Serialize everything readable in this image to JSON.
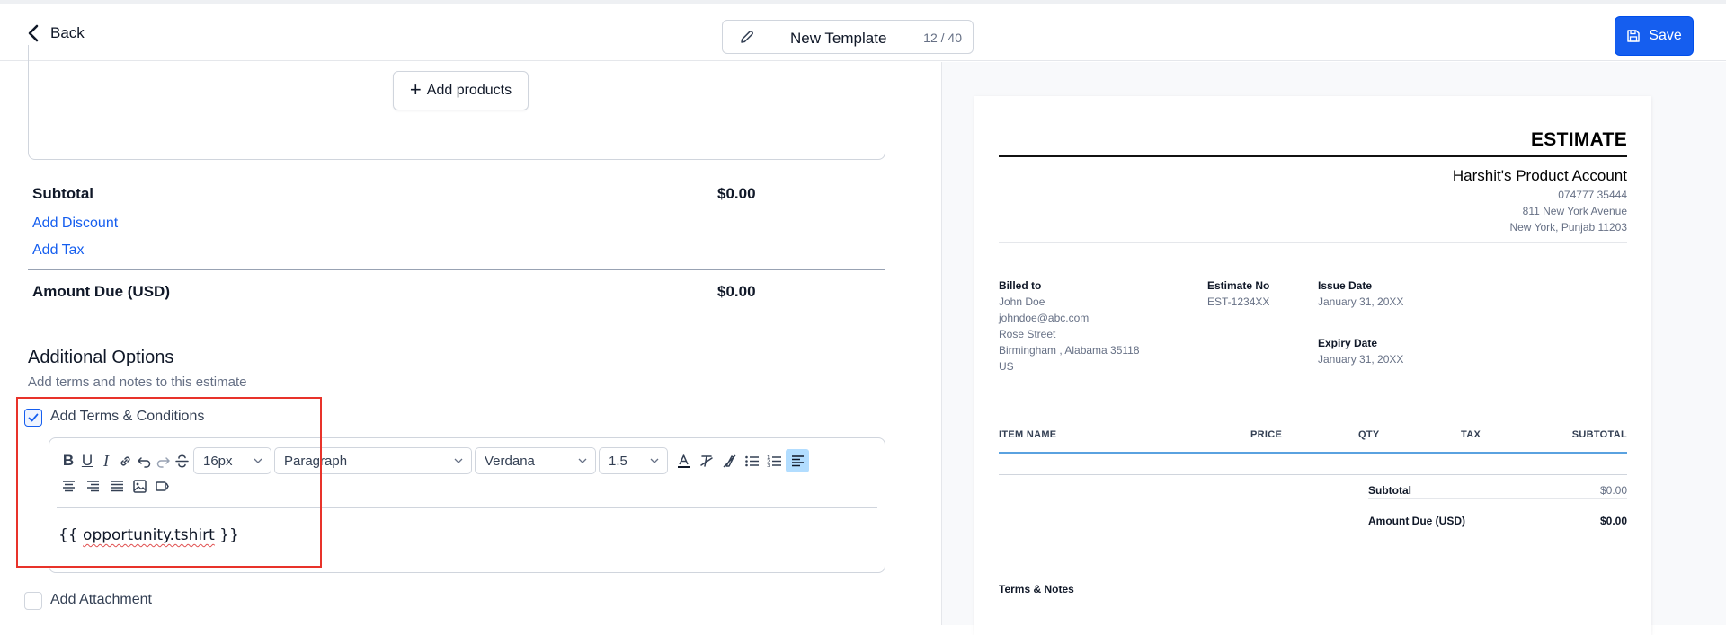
{
  "header": {
    "back_label": "Back",
    "template_title": "New Template",
    "title_count": "12 / 40",
    "save_label": "Save",
    "accent_color": "#155eef"
  },
  "products": {
    "add_products_label": "Add products"
  },
  "totals": {
    "subtotal_label": "Subtotal",
    "subtotal_value": "$0.00",
    "add_discount_label": "Add Discount",
    "add_tax_label": "Add Tax",
    "amount_due_label": "Amount Due (USD)",
    "amount_due_value": "$0.00"
  },
  "additional_options": {
    "title": "Additional Options",
    "subtitle": "Add terms and notes to this estimate",
    "terms_label": "Add Terms & Conditions",
    "terms_checked": true,
    "attachment_label": "Add Attachment",
    "attachment_checked": false
  },
  "editor": {
    "font_size": "16px",
    "block_type": "Paragraph",
    "font_family": "Verdana",
    "line_height": "1.5",
    "content": "{{ opportunity.tshirt }}",
    "content_open": "{{ ",
    "content_var": "opportunity.tshirt",
    "content_close": " }}"
  },
  "preview": {
    "doc_title": "ESTIMATE",
    "account_name": "Harshit's Product Account",
    "account_phone": "074777 35444",
    "account_address1": "811 New York Avenue",
    "account_address2": "New York, Punjab 11203",
    "billed_to_label": "Billed to",
    "billed_to": {
      "name": "John Doe",
      "email": "johndoe@abc.com",
      "street": "Rose Street",
      "city": "Birmingham , Alabama 35118",
      "country": "US"
    },
    "estimate_no_label": "Estimate No",
    "estimate_no": "EST-1234XX",
    "issue_date_label": "Issue Date",
    "issue_date": "January 31, 20XX",
    "expiry_date_label": "Expiry Date",
    "expiry_date": "January 31, 20XX",
    "columns": [
      "ITEM NAME",
      "PRICE",
      "QTY",
      "TAX",
      "SUBTOTAL"
    ],
    "subtotal_label": "Subtotal",
    "subtotal_value": "$0.00",
    "amount_due_label": "Amount Due (USD)",
    "amount_due_value": "$0.00",
    "terms_notes_label": "Terms & Notes"
  }
}
